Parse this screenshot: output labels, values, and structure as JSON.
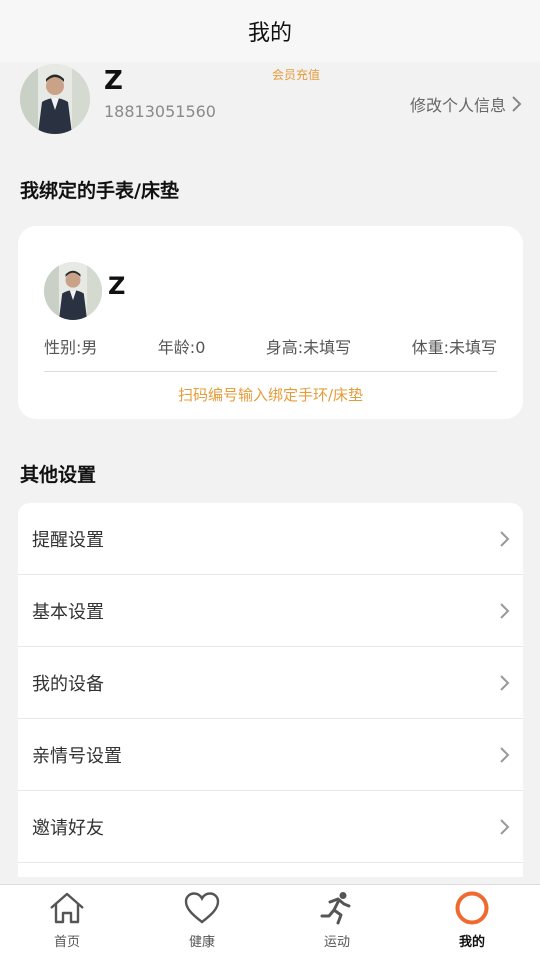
{
  "header": {
    "title": "我的"
  },
  "profile": {
    "name": "Z",
    "phone": "18813051560",
    "vip_label": "会员充值",
    "edit_label": "修改个人信息"
  },
  "bound_section": {
    "title": "我绑定的手表/床垫",
    "card": {
      "name": "Z",
      "gender": "性别:男",
      "age": "年龄:0",
      "height": "身高:未填写",
      "weight": "体重:未填写",
      "bind_link": "扫码编号输入绑定手环/床垫"
    }
  },
  "other_section": {
    "title": "其他设置",
    "items": [
      {
        "label": "提醒设置"
      },
      {
        "label": "基本设置"
      },
      {
        "label": "我的设备"
      },
      {
        "label": "亲情号设置"
      },
      {
        "label": "邀请好友"
      }
    ]
  },
  "tabbar": {
    "tabs": [
      {
        "label": "首页",
        "icon": "home-icon"
      },
      {
        "label": "健康",
        "icon": "heart-icon"
      },
      {
        "label": "运动",
        "icon": "running-icon"
      },
      {
        "label": "我的",
        "icon": "ring-icon"
      }
    ],
    "active_index": 3
  },
  "colors": {
    "accent": "#e59c3a",
    "active_tab_ring": "#ee6a2f",
    "background": "#f2f2f2"
  }
}
